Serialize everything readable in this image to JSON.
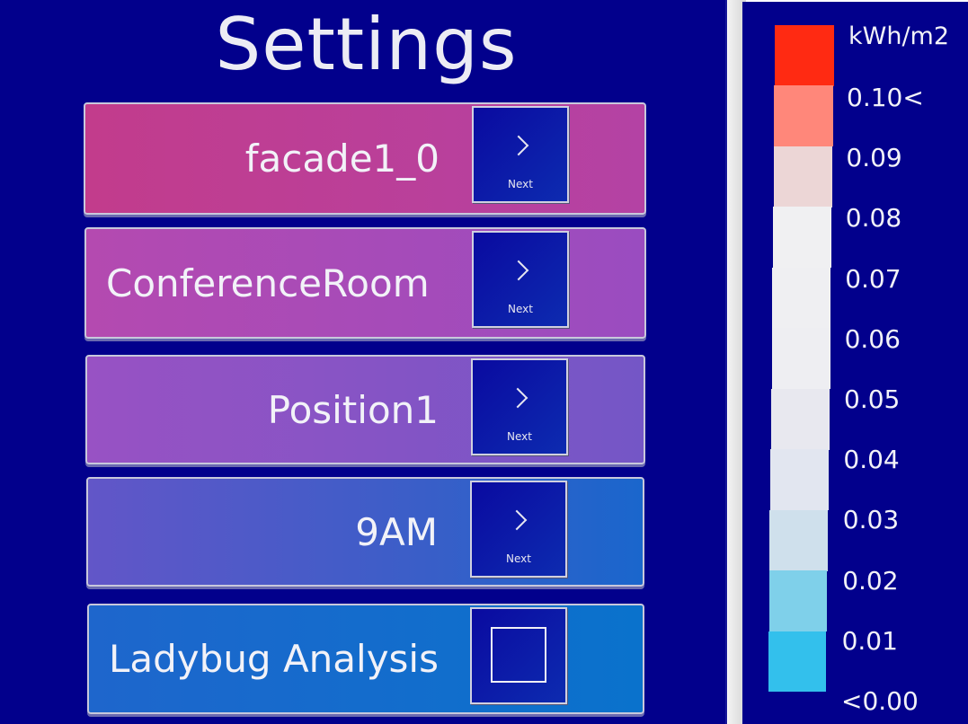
{
  "settings": {
    "title": "Settings",
    "rows": [
      {
        "label": "facade1_0",
        "button_label": "Next"
      },
      {
        "label": "ConferenceRoom",
        "button_label": "Next"
      },
      {
        "label": "Position1",
        "button_label": "Next"
      },
      {
        "label": "9AM",
        "button_label": "Next"
      },
      {
        "label": "Ladybug Analysis",
        "checked": false
      }
    ]
  },
  "legend": {
    "unit": "kWh/m2",
    "labels": [
      "0.10<",
      "0.09",
      "0.08",
      "0.07",
      "0.06",
      "0.05",
      "0.04",
      "0.03",
      "0.02",
      "0.01",
      "<0.00"
    ],
    "colors": [
      "#ff2a12",
      "#ff877a",
      "#ecd6d6",
      "#f0f0f2",
      "#efeff2",
      "#eeeef2",
      "#e8e8ef",
      "#e2e6f0",
      "#cfe0ec",
      "#7fd0ea",
      "#33c0ec"
    ]
  }
}
